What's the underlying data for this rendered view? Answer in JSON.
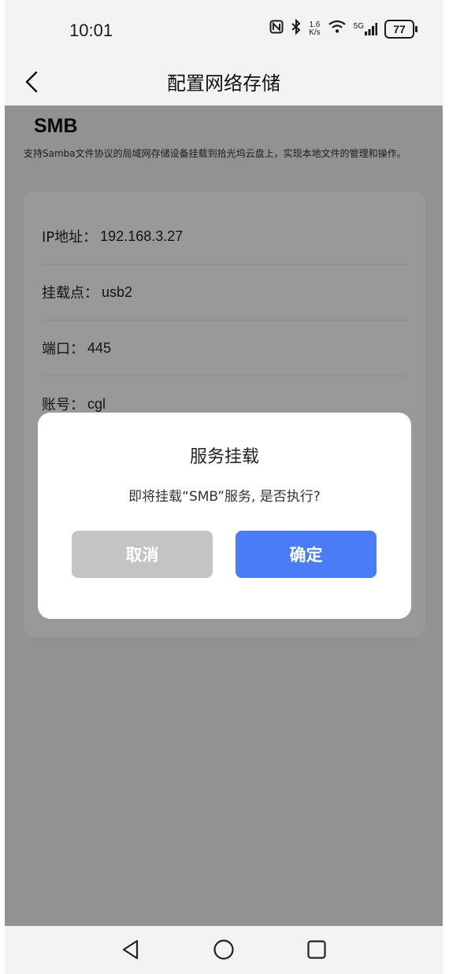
{
  "status_bar": {
    "time": "10:01",
    "net_speed_top": "1.6",
    "net_speed_bottom": "K/s",
    "signal_label": "5G",
    "battery": "77",
    "icons": [
      "nfc-icon",
      "bluetooth-icon",
      "wifi-icon",
      "cellular-signal-icon",
      "battery-icon"
    ]
  },
  "app_bar": {
    "title": "配置网络存储",
    "back_icon": "back-chevron-icon"
  },
  "content": {
    "heading": "SMB",
    "description": "支持Samba文件协议的局域网存储设备挂载到拾光坞云盘上，实现本地文件的管理和操作。",
    "fields": [
      {
        "label": "IP地址：",
        "value": "192.168.3.27"
      },
      {
        "label": "挂载点：",
        "value": "usb2"
      },
      {
        "label": "端口：",
        "value": "445"
      },
      {
        "label": "账号：",
        "value": "cgl"
      }
    ]
  },
  "dialog": {
    "title": "服务挂载",
    "message": "即将挂载“SMB”服务, 是否执行?",
    "cancel_label": "取消",
    "confirm_label": "确定",
    "cancel_color": "#c4c4c4",
    "confirm_color": "#4a7cf7"
  },
  "nav_bar": {
    "icons": [
      "nav-back-icon",
      "nav-home-icon",
      "nav-recents-icon"
    ]
  }
}
